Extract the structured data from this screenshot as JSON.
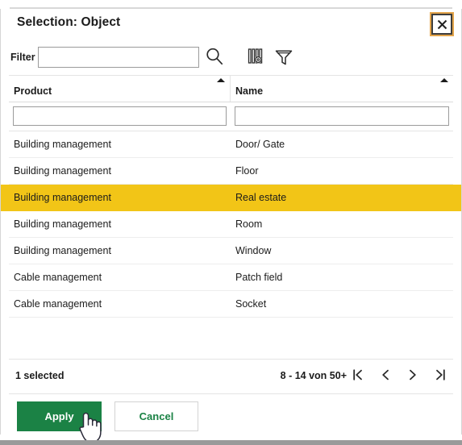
{
  "dialog": {
    "title": "Selection: Object",
    "close_label": "×",
    "close_icon": "close-icon"
  },
  "toolbar": {
    "filter_label": "Filter",
    "filter_value": "",
    "filter_placeholder": "",
    "search_icon": "search-icon",
    "columns_settings_icon": "columns-settings-icon",
    "funnel_icon": "filter-funnel-icon"
  },
  "table": {
    "columns": [
      {
        "key": "product",
        "label": "Product",
        "sort": "asc",
        "filter_value": "",
        "filter_placeholder": ""
      },
      {
        "key": "name",
        "label": "Name",
        "sort": "asc",
        "filter_value": "",
        "filter_placeholder": ""
      }
    ],
    "rows": [
      {
        "product": "Building management",
        "name": "Door/ Gate",
        "selected": false
      },
      {
        "product": "Building management",
        "name": "Floor",
        "selected": false
      },
      {
        "product": "Building management",
        "name": "Real estate",
        "selected": true
      },
      {
        "product": "Building management",
        "name": "Room",
        "selected": false
      },
      {
        "product": "Building management",
        "name": "Window",
        "selected": false
      },
      {
        "product": "Cable management",
        "name": "Patch field",
        "selected": false
      },
      {
        "product": "Cable management",
        "name": "Socket",
        "selected": false
      }
    ]
  },
  "footer": {
    "selected_count": "1 selected",
    "page_range": "8 - 14 von 50+",
    "pager": [
      {
        "name": "first-page-button",
        "glyph": "|<"
      },
      {
        "name": "previous-page-button",
        "glyph": "<"
      },
      {
        "name": "next-page-button",
        "glyph": ">"
      },
      {
        "name": "last-page-button",
        "glyph": ">|"
      }
    ]
  },
  "actions": {
    "apply_label": "Apply",
    "cancel_label": "Cancel"
  },
  "colors": {
    "accent_green": "#1b8245",
    "selection_yellow": "#f2c517",
    "border_gray": "#d6d6d6",
    "focus_orange": "#e3a44a"
  }
}
